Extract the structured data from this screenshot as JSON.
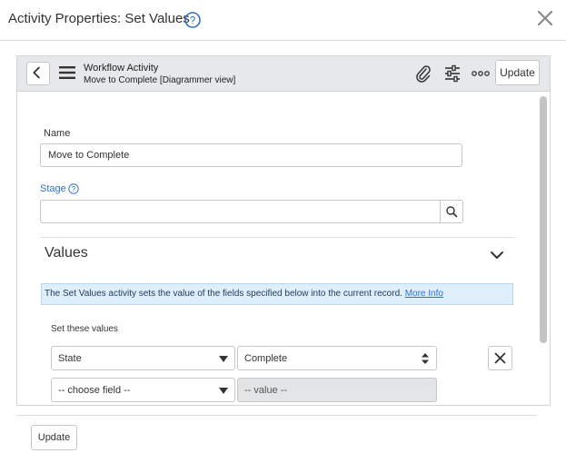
{
  "dialog": {
    "title": "Activity Properties: Set Values"
  },
  "form_header": {
    "kind": "Workflow Activity",
    "record": "Move to Complete [Diagrammer view]",
    "update_label": "Update"
  },
  "fields": {
    "name_label": "Name",
    "name_value": "Move to Complete",
    "stage_label": "Stage",
    "stage_value": ""
  },
  "values_section": {
    "title": "Values",
    "info_text": "The Set Values activity sets the value of the fields specified below into the current record.",
    "info_link": "More Info",
    "set_label": "Set these values",
    "rows": [
      {
        "field": "State",
        "value": "Complete"
      },
      {
        "field": "-- choose field --",
        "value": "-- value --"
      }
    ]
  },
  "footer": {
    "update_label": "Update"
  },
  "colors": {
    "accent": "#2f73c9",
    "header_bg": "#e6e8ea",
    "info_bg": "#deeefb"
  },
  "icons": [
    "help-icon",
    "close-icon",
    "back-icon",
    "menu-icon",
    "paperclip-icon",
    "sliders-icon",
    "more-icon",
    "search-icon",
    "chevron-down-icon",
    "remove-icon"
  ]
}
